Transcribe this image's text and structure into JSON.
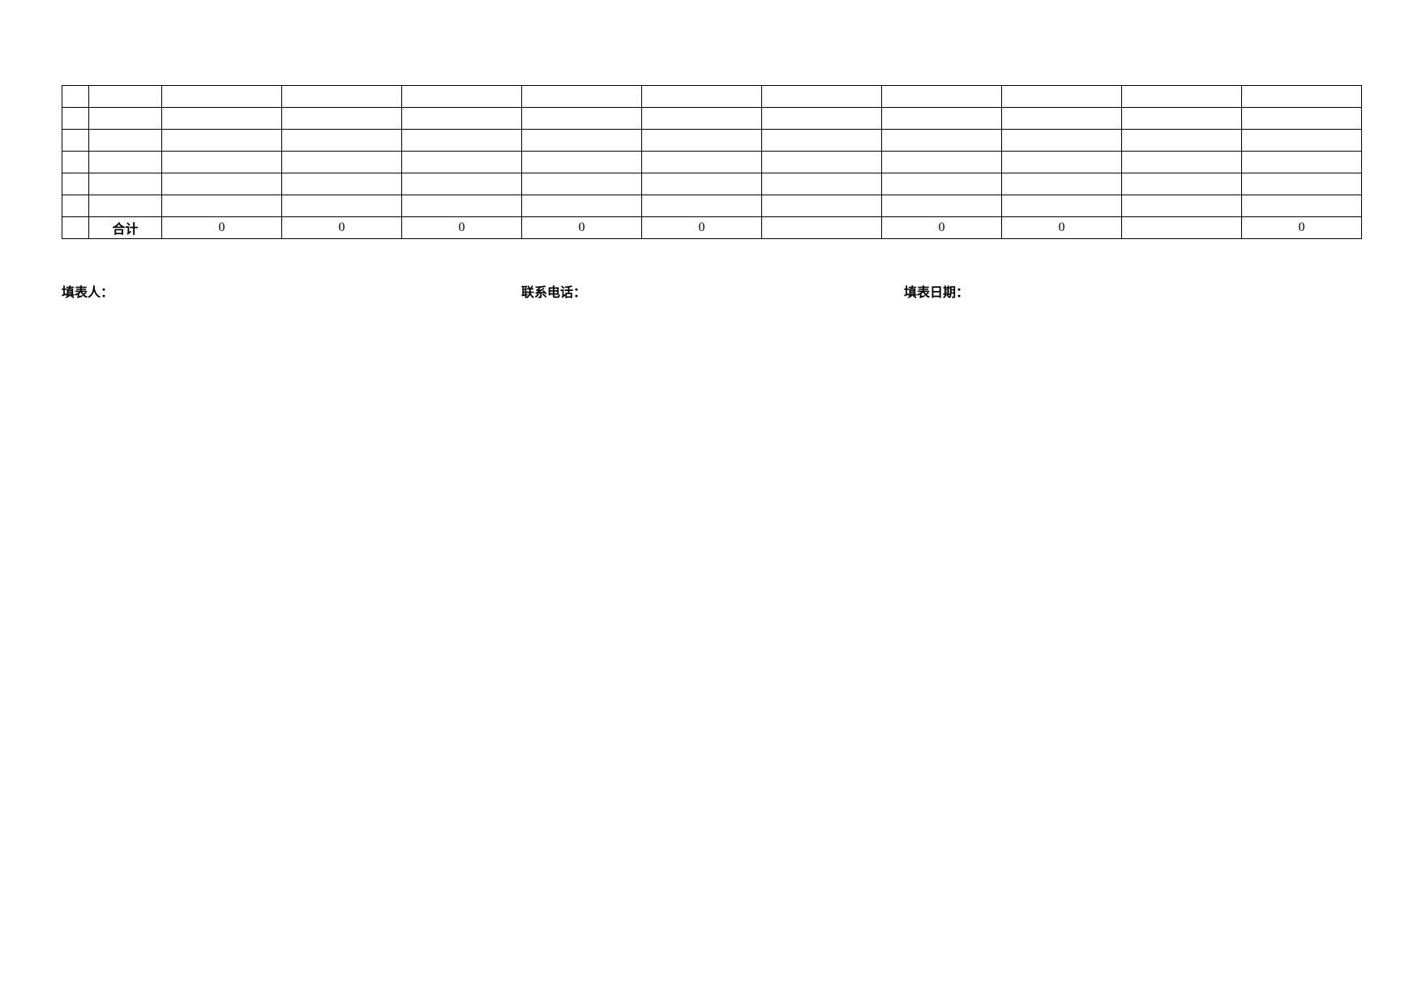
{
  "table": {
    "rows": [
      {
        "cells": [
          "",
          "",
          "",
          "",
          "",
          "",
          "",
          "",
          "",
          "",
          "",
          ""
        ]
      },
      {
        "cells": [
          "",
          "",
          "",
          "",
          "",
          "",
          "",
          "",
          "",
          "",
          "",
          ""
        ]
      },
      {
        "cells": [
          "",
          "",
          "",
          "",
          "",
          "",
          "",
          "",
          "",
          "",
          "",
          ""
        ]
      },
      {
        "cells": [
          "",
          "",
          "",
          "",
          "",
          "",
          "",
          "",
          "",
          "",
          "",
          ""
        ]
      },
      {
        "cells": [
          "",
          "",
          "",
          "",
          "",
          "",
          "",
          "",
          "",
          "",
          "",
          ""
        ]
      },
      {
        "cells": [
          "",
          "",
          "",
          "",
          "",
          "",
          "",
          "",
          "",
          "",
          "",
          ""
        ]
      },
      {
        "cells": [
          "",
          "合计",
          "0",
          "0",
          "0",
          "0",
          "0",
          "",
          "0",
          "0",
          "",
          "0"
        ]
      }
    ]
  },
  "footer": {
    "filler_label": "填表人：",
    "phone_label": "联系电话：",
    "date_label": "填表日期："
  }
}
